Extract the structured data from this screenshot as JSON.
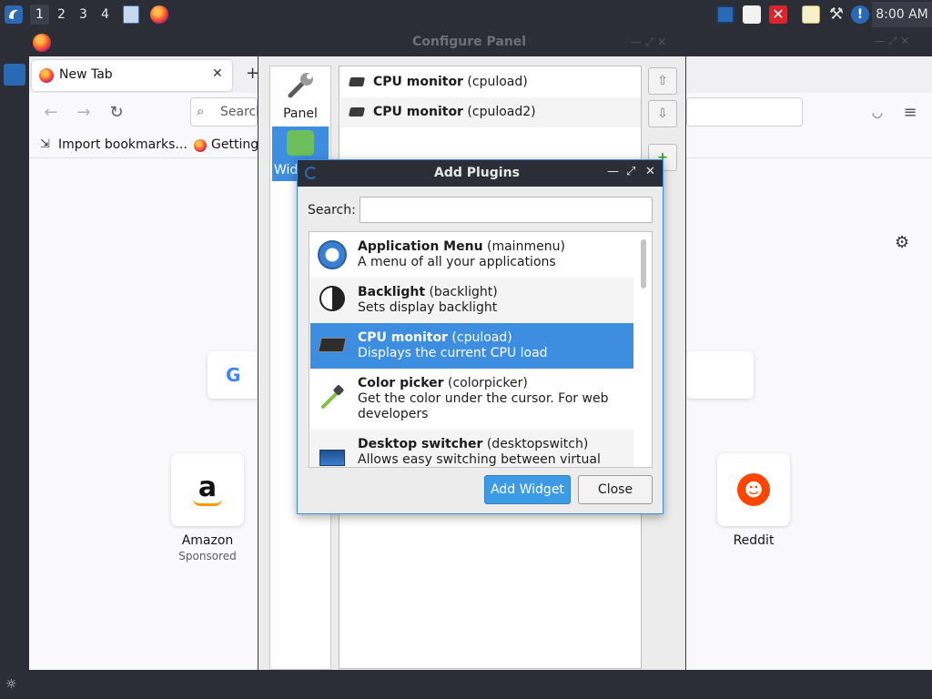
{
  "top_panel": {
    "workspaces": [
      "1",
      "2",
      "3",
      "4"
    ],
    "active_workspace": "1",
    "clock": "8:00 AM",
    "icons": [
      "app-menu-icon",
      "file-manager-icon",
      "firefox-icon",
      "network-icon",
      "clipboard-icon",
      "close-red-icon",
      "notes-icon",
      "tools-icon",
      "info-icon"
    ]
  },
  "firefox": {
    "tab_title": "New Tab",
    "search_placeholder": "Search",
    "bookmarks": [
      "Import bookmarks...",
      "Getting"
    ],
    "tiles": [
      {
        "name": "Amazon",
        "sub": "Sponsored"
      },
      {
        "name": "Reddit",
        "sub": ""
      }
    ]
  },
  "configure_panel": {
    "title": "Configure Panel",
    "sidebar": [
      {
        "label": "Panel",
        "icon": "wrench-icon"
      },
      {
        "label": "Wid",
        "icon": "puzzle-icon"
      }
    ],
    "widgets": [
      {
        "bold": "CPU monitor",
        "id": "(cpuload)"
      },
      {
        "bold": "CPU monitor",
        "id": "(cpuload2)"
      }
    ]
  },
  "add_plugins": {
    "title": "Add Plugins",
    "search_label": "Search:",
    "search_value": "",
    "items": [
      {
        "bold": "Application Menu",
        "id": "(mainmenu)",
        "desc": "A menu of all your applications",
        "icon": "app-menu-icon"
      },
      {
        "bold": "Backlight",
        "id": "(backlight)",
        "desc": "Sets display backlight",
        "icon": "brightness-icon"
      },
      {
        "bold": "CPU monitor",
        "id": "(cpuload)",
        "desc": "Displays the current CPU load",
        "icon": "cpu-icon"
      },
      {
        "bold": "Color picker",
        "id": "(colorpicker)",
        "desc": "Get the color under the cursor. For web developers",
        "icon": "color-picker-icon"
      },
      {
        "bold": "Desktop switcher",
        "id": "(desktopswitch)",
        "desc": "Allows easy switching between virtual",
        "icon": "desktop-switcher-icon"
      }
    ],
    "add_button": "Add Widget",
    "close_button": "Close"
  }
}
